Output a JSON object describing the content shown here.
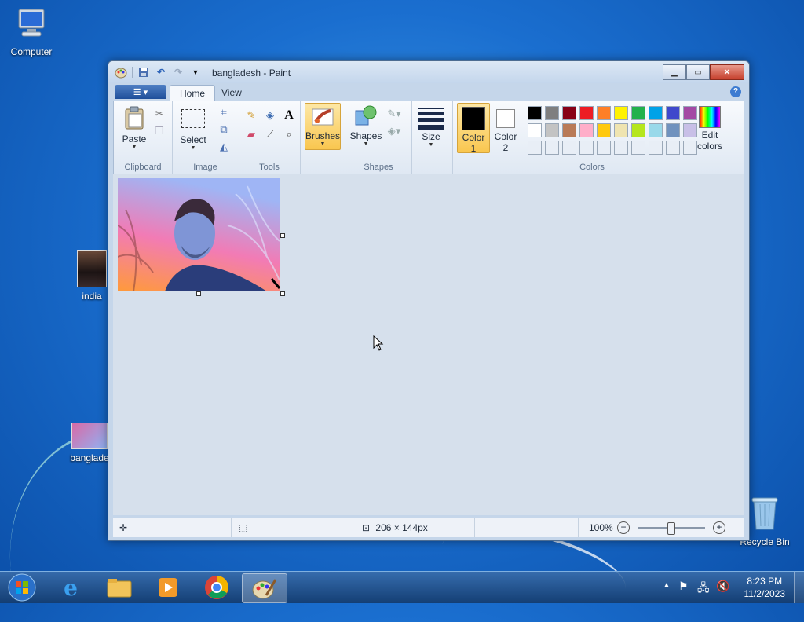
{
  "desktop": {
    "icons": [
      {
        "label": "Computer"
      },
      {
        "label": "india"
      },
      {
        "label": "banglade"
      },
      {
        "label": "Recycle Bin"
      }
    ]
  },
  "window": {
    "title": "bangladesh - Paint",
    "tabs": [
      {
        "label": "Home",
        "active": true
      },
      {
        "label": "View",
        "active": false
      }
    ]
  },
  "ribbon": {
    "clipboard": {
      "label": "Clipboard",
      "paste": "Paste"
    },
    "image": {
      "label": "Image",
      "select": "Select"
    },
    "tools": {
      "label": "Tools"
    },
    "brushes": {
      "label": "Brushes"
    },
    "shapes": {
      "label": "Shapes",
      "shapes_btn": "Shapes"
    },
    "size": {
      "label": "Size"
    },
    "colors": {
      "label": "Colors",
      "color1": {
        "line1": "Color",
        "line2": "1",
        "value": "#000000"
      },
      "color2": {
        "line1": "Color",
        "line2": "2",
        "value": "#ffffff"
      },
      "edit": {
        "line1": "Edit",
        "line2": "colors"
      },
      "palette_row1": [
        "#000000",
        "#7f7f7f",
        "#880015",
        "#ed1c24",
        "#ff7f27",
        "#fff200",
        "#22b14c",
        "#00a2e8",
        "#3f48cc",
        "#a349a4"
      ],
      "palette_row2": [
        "#ffffff",
        "#c3c3c3",
        "#b97a57",
        "#ffaec9",
        "#ffc90e",
        "#efe4b0",
        "#b5e61d",
        "#99d9ea",
        "#7092be",
        "#c8bfe7"
      ]
    }
  },
  "status": {
    "dimensions": "206 × 144px",
    "zoom": "100%"
  },
  "taskbar": {
    "time": "8:23 PM",
    "date": "11/2/2023"
  }
}
